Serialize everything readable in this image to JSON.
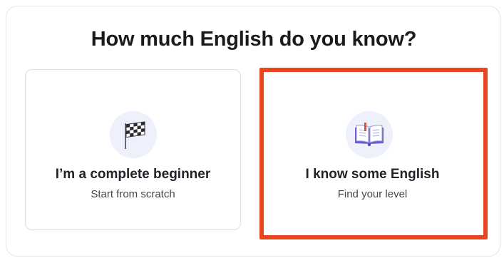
{
  "heading": "How much English do you know?",
  "options": [
    {
      "title": "I’m a complete beginner",
      "subtitle": "Start from scratch",
      "icon": "checkered-flag-icon"
    },
    {
      "title": "I know some English",
      "subtitle": "Find your level",
      "icon": "open-book-icon",
      "highlighted": true
    }
  ],
  "colors": {
    "highlight_border": "#e8461f",
    "icon_background": "#eef0fb",
    "card_border": "#dadde3",
    "book_accent": "#6a5bd6"
  }
}
